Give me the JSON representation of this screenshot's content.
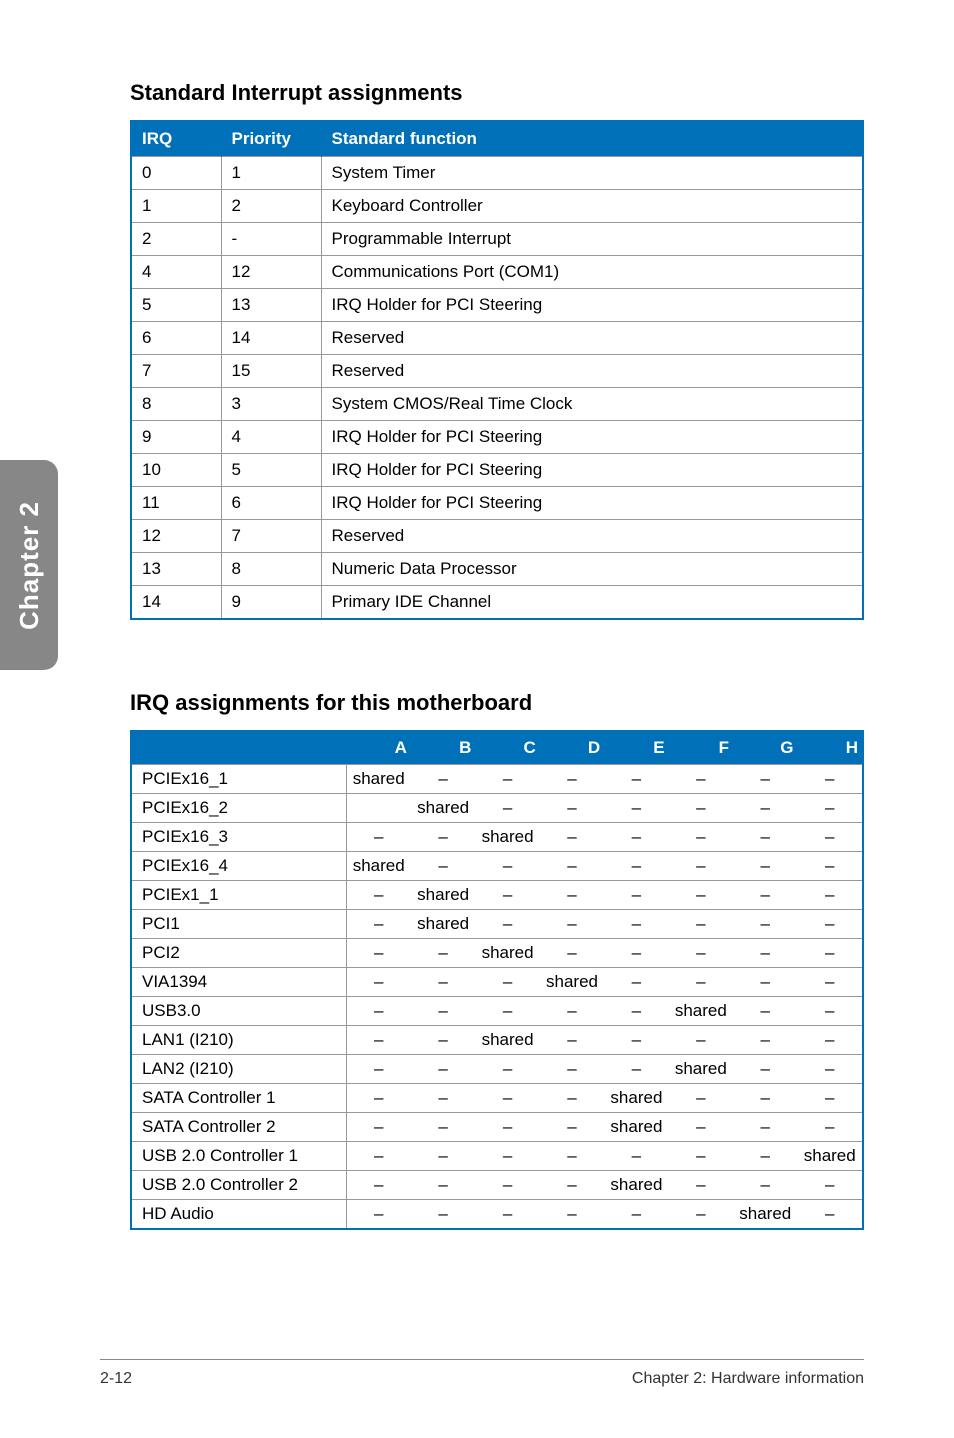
{
  "sideTab": "Chapter 2",
  "section1": {
    "title": "Standard Interrupt assignments",
    "headers": [
      "IRQ",
      "Priority",
      "Standard function"
    ],
    "rows": [
      {
        "irq": "0",
        "priority": "1",
        "func": "System Timer"
      },
      {
        "irq": "1",
        "priority": "2",
        "func": "Keyboard Controller"
      },
      {
        "irq": "2",
        "priority": "-",
        "func": "Programmable Interrupt"
      },
      {
        "irq": "4",
        "priority": "12",
        "func": "Communications Port (COM1)"
      },
      {
        "irq": "5",
        "priority": "13",
        "func": "IRQ Holder for PCI Steering"
      },
      {
        "irq": "6",
        "priority": "14",
        "func": "Reserved"
      },
      {
        "irq": "7",
        "priority": "15",
        "func": "Reserved"
      },
      {
        "irq": "8",
        "priority": "3",
        "func": "System CMOS/Real Time Clock"
      },
      {
        "irq": "9",
        "priority": "4",
        "func": "IRQ Holder for PCI Steering"
      },
      {
        "irq": "10",
        "priority": "5",
        "func": "IRQ Holder for PCI Steering"
      },
      {
        "irq": "11",
        "priority": "6",
        "func": "IRQ Holder for PCI Steering"
      },
      {
        "irq": "12",
        "priority": "7",
        "func": "Reserved"
      },
      {
        "irq": "13",
        "priority": "8",
        "func": "Numeric Data Processor"
      },
      {
        "irq": "14",
        "priority": "9",
        "func": "Primary IDE Channel"
      }
    ]
  },
  "section2": {
    "title": "IRQ assignments for this motherboard",
    "cols": [
      "A",
      "B",
      "C",
      "D",
      "E",
      "F",
      "G",
      "H"
    ],
    "rows": [
      {
        "label": "PCIEx16_1",
        "vals": [
          "shared",
          "–",
          "–",
          "–",
          "–",
          "–",
          "–",
          "–"
        ]
      },
      {
        "label": "PCIEx16_2",
        "vals": [
          "",
          "shared",
          "–",
          "–",
          "–",
          "–",
          "–",
          "–"
        ]
      },
      {
        "label": "PCIEx16_3",
        "vals": [
          "–",
          "–",
          "shared",
          "–",
          "–",
          "–",
          "–",
          "–"
        ]
      },
      {
        "label": "PCIEx16_4",
        "vals": [
          "shared",
          "–",
          "–",
          "–",
          "–",
          "–",
          "–",
          "–"
        ]
      },
      {
        "label": "PCIEx1_1",
        "vals": [
          "–",
          "shared",
          "–",
          "–",
          "–",
          "–",
          "–",
          "–"
        ]
      },
      {
        "label": "PCI1",
        "vals": [
          "–",
          "shared",
          "–",
          "–",
          "–",
          "–",
          "–",
          "–"
        ]
      },
      {
        "label": "PCI2",
        "vals": [
          "–",
          "–",
          "shared",
          "–",
          "–",
          "–",
          "–",
          "–"
        ]
      },
      {
        "label": "VIA1394",
        "vals": [
          "–",
          "–",
          "–",
          "shared",
          "–",
          "–",
          "–",
          "–"
        ]
      },
      {
        "label": "USB3.0",
        "vals": [
          "–",
          "–",
          "–",
          "–",
          "–",
          "shared",
          "–",
          "–"
        ]
      },
      {
        "label": "LAN1 (I210)",
        "vals": [
          "–",
          "–",
          "shared",
          "–",
          "–",
          "–",
          "–",
          "–"
        ]
      },
      {
        "label": "LAN2 (I210)",
        "vals": [
          "–",
          "–",
          "–",
          "–",
          "–",
          "shared",
          "–",
          "–"
        ]
      },
      {
        "label": "SATA Controller 1",
        "vals": [
          "–",
          "–",
          "–",
          "–",
          "shared",
          "–",
          "–",
          "–"
        ]
      },
      {
        "label": "SATA Controller 2",
        "vals": [
          "–",
          "–",
          "–",
          "–",
          "shared",
          "–",
          "–",
          "–"
        ]
      },
      {
        "label": "USB 2.0 Controller 1",
        "vals": [
          "–",
          "–",
          "–",
          "–",
          "–",
          "–",
          "–",
          "shared"
        ]
      },
      {
        "label": "USB 2.0 Controller 2",
        "vals": [
          "–",
          "–",
          "–",
          "–",
          "shared",
          "–",
          "–",
          "–"
        ]
      },
      {
        "label": "HD Audio",
        "vals": [
          "–",
          "–",
          "–",
          "–",
          "–",
          "–",
          "shared",
          "–"
        ]
      }
    ]
  },
  "footer": {
    "left": "2-12",
    "right": "Chapter 2: Hardware information"
  }
}
